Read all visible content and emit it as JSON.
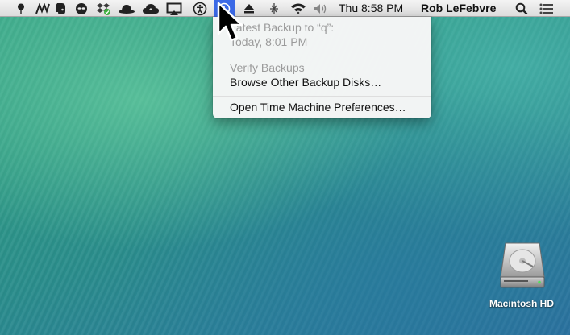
{
  "menubar": {
    "clock": "Thu 8:58 PM",
    "user": "Rob LeFebvre",
    "extras": [
      "pin-icon",
      "teamviewer-icon",
      "evernote-icon",
      "alien-icon",
      "dropbox-icon",
      "bowler-hat-icon",
      "cloud-icon",
      "airplay-icon",
      "accessibility-icon",
      "time-machine-icon",
      "eject-icon",
      "bluetooth-icon",
      "wifi-icon",
      "volume-icon",
      "spotlight-icon",
      "notification-center-icon"
    ]
  },
  "time_machine_menu": {
    "latest_backup_label": "Latest Backup to “q”:",
    "latest_backup_time": "Today, 8:01 PM",
    "items": [
      {
        "label": "Verify Backups",
        "enabled": false
      },
      {
        "label": "Browse Other Backup Disks…",
        "enabled": true
      },
      {
        "label": "Open Time Machine Preferences…",
        "enabled": true
      }
    ]
  },
  "desktop": {
    "disk_label": "Macintosh HD"
  },
  "colors": {
    "menu_highlight": "#3b69e6",
    "disabled_text": "#9b9b9b"
  }
}
